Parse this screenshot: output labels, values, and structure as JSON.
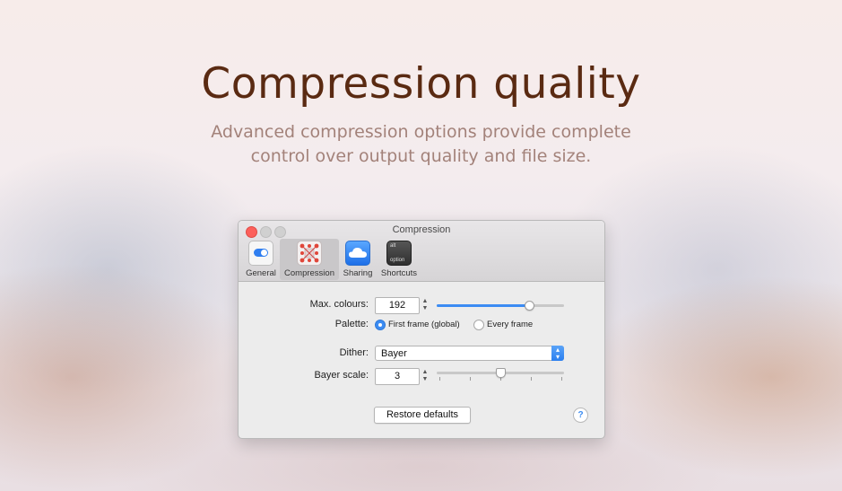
{
  "hero": {
    "title": "Compression quality",
    "subtitle": "Advanced compression options provide complete control over output quality and file size."
  },
  "window": {
    "title": "Compression",
    "toolbar": [
      {
        "label": "General",
        "icon": "toggle-switch-icon"
      },
      {
        "label": "Compression",
        "icon": "compression-icon",
        "selected": true
      },
      {
        "label": "Sharing",
        "icon": "cloud-icon"
      },
      {
        "label": "Shortcuts",
        "icon": "keyboard-key-icon",
        "key_top": "alt",
        "key_bottom": "option"
      }
    ]
  },
  "settings": {
    "max_colours": {
      "label": "Max. colours:",
      "value": "192",
      "slider_fraction": 0.73
    },
    "palette": {
      "label": "Palette:",
      "options": [
        "First frame (global)",
        "Every frame"
      ],
      "selected": "First frame (global)"
    },
    "dither": {
      "label": "Dither:",
      "value": "Bayer"
    },
    "bayer_scale": {
      "label": "Bayer scale:",
      "value": "3",
      "slider_fraction": 0.5
    },
    "restore_defaults_label": "Restore defaults",
    "help_label": "?"
  },
  "colors": {
    "accent": "#3c8cf3",
    "title": "#5a2a12",
    "subtitle": "#a3827a"
  }
}
